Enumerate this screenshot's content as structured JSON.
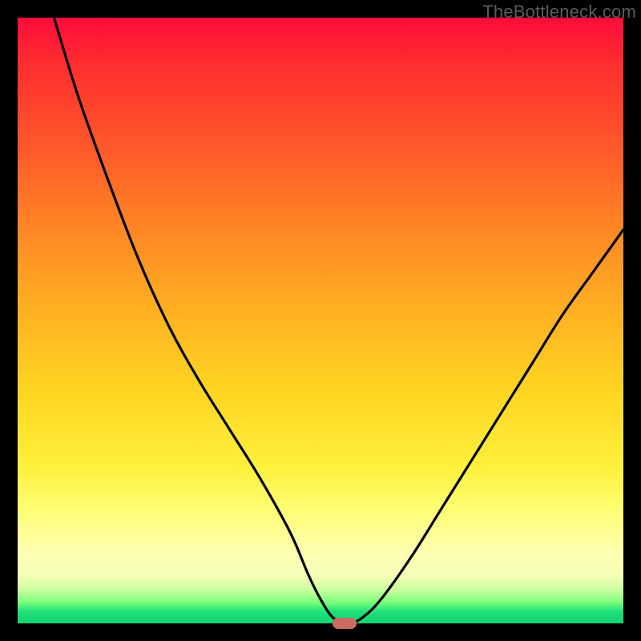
{
  "watermark": "TheBottleneck.com",
  "colors": {
    "frame": "#000000",
    "curve": "#000000",
    "marker": "#cc6b61",
    "gradient_stops": [
      "#ff0b3a",
      "#ff2f2f",
      "#ff5a2a",
      "#ff8a24",
      "#ffb522",
      "#ffd622",
      "#fff03c",
      "#ffff7a",
      "#ffffb0",
      "#f6ffb8",
      "#c9ff9e",
      "#7bff7b",
      "#22e07a",
      "#0fd36f"
    ]
  },
  "chart_data": {
    "type": "line",
    "title": "",
    "xlabel": "",
    "ylabel": "",
    "xlim": [
      0,
      100
    ],
    "ylim": [
      0,
      100
    ],
    "grid": false,
    "legend": false,
    "series": [
      {
        "name": "bottleneck-curve",
        "x": [
          6,
          10,
          15,
          20,
          25,
          30,
          35,
          40,
          45,
          48,
          50,
          52,
          54,
          55,
          57,
          60,
          65,
          70,
          75,
          80,
          85,
          90,
          95,
          100
        ],
        "y": [
          100,
          87,
          73,
          60,
          49,
          40,
          32,
          24,
          15,
          8,
          4,
          1,
          0,
          0,
          1,
          4,
          11,
          19,
          27,
          35,
          43,
          51,
          58,
          65
        ]
      }
    ],
    "annotations": [
      {
        "name": "optimum-marker",
        "x": 54,
        "y": 0,
        "shape": "pill",
        "color": "#cc6b61"
      }
    ]
  }
}
